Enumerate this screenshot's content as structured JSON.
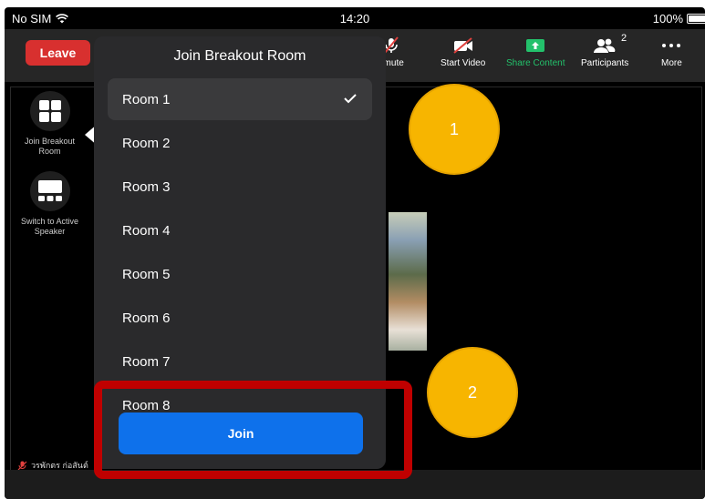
{
  "status_bar": {
    "carrier": "No SIM",
    "time": "14:20",
    "battery": "100%"
  },
  "toolbar": {
    "leave_label": "Leave",
    "unmute_label": "nmute",
    "start_video_label": "Start Video",
    "share_content_label": "Share Content",
    "participants_label": "Participants",
    "participants_count": "2",
    "more_label": "More"
  },
  "side_controls": {
    "join_breakout_label": "Join Breakout Room",
    "switch_speaker_label": "Switch to Active Speaker"
  },
  "participant_caption": "วรพักตร ก่อสันต์",
  "breakout_panel": {
    "title": "Join Breakout Room",
    "rooms": [
      {
        "label": "Room 1",
        "selected": true
      },
      {
        "label": "Room 2",
        "selected": false
      },
      {
        "label": "Room 3",
        "selected": false
      },
      {
        "label": "Room 4",
        "selected": false
      },
      {
        "label": "Room 5",
        "selected": false
      },
      {
        "label": "Room 6",
        "selected": false
      },
      {
        "label": "Room 7",
        "selected": false
      },
      {
        "label": "Room 8",
        "selected": false
      }
    ],
    "join_label": "Join"
  },
  "annotations": {
    "step_1": "1",
    "step_2": "2"
  },
  "colors": {
    "leave_red": "#d8302f",
    "share_green": "#23c16b",
    "join_blue": "#0e71eb",
    "highlight_red": "#c00000",
    "badge_yellow": "#f7b500"
  }
}
